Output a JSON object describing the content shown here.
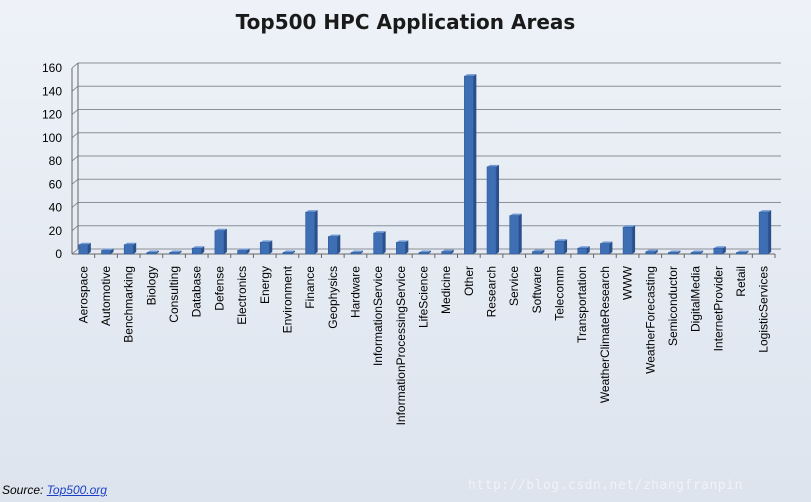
{
  "chart_data": {
    "type": "bar",
    "title": "Top500 HPC Application Areas",
    "xlabel": "",
    "ylabel": "",
    "ylim": [
      0,
      160
    ],
    "yticks": [
      0,
      20,
      40,
      60,
      80,
      100,
      120,
      140,
      160
    ],
    "grid": true,
    "bar_color": "#3e6fb5",
    "categories": [
      "Aerospace",
      "Automotive",
      "Benchmarking",
      "Biology",
      "Consulting",
      "Database",
      "Defense",
      "Electronics",
      "Energy",
      "Environment",
      "Finance",
      "Geophysics",
      "Hardware",
      "InformationService",
      "InformationProcessingService",
      "LifeScience",
      "Medicine",
      "Other",
      "Research",
      "Service",
      "Software",
      "Telecomm",
      "Transportation",
      "WeatherClimateResearch",
      "WWW",
      "WeatherForecasting",
      "Semiconductor",
      "DigitalMedia",
      "InternetProvider",
      "Retail",
      "LogisticServices"
    ],
    "values": [
      8,
      3,
      8,
      1,
      1,
      5,
      20,
      3,
      10,
      1,
      36,
      15,
      1,
      18,
      10,
      1,
      2,
      153,
      75,
      33,
      2,
      11,
      5,
      9,
      23,
      2,
      1,
      1,
      5,
      1,
      36
    ]
  },
  "source": {
    "prefix": "Source: ",
    "link_text": "Top500.org"
  },
  "watermark": "http://blog.csdn.net/zhangfranpin"
}
